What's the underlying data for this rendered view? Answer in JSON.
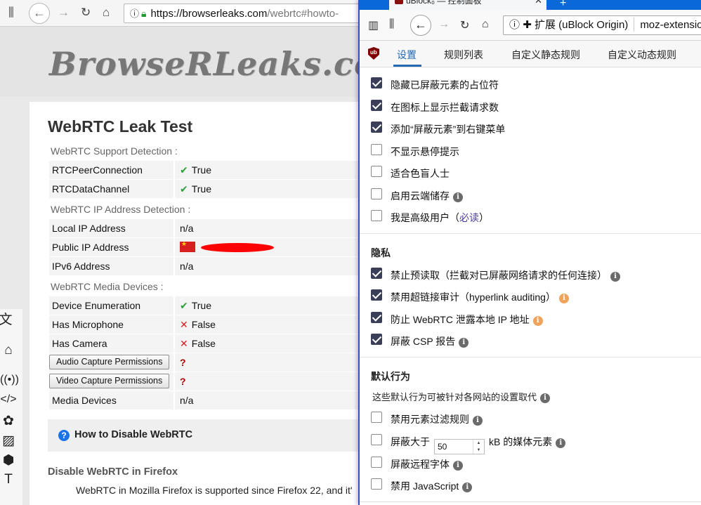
{
  "background_browser": {
    "url_host": "https://browserleaks.com",
    "url_path": "/webrtc#howto-",
    "logo_text": "BrowseRLeaks.com",
    "page_title": "WebRTC Leak Test",
    "support_section": "WebRTC Support Detection :",
    "ip_section": "WebRTC IP Address Detection :",
    "media_section": "WebRTC Media Devices :",
    "rows": {
      "rtcpeer": {
        "key": "RTCPeerConnection",
        "value": "True"
      },
      "rtcdata": {
        "key": "RTCDataChannel",
        "value": "True"
      },
      "local_ip": {
        "key": "Local IP Address",
        "value": "n/a"
      },
      "public_ip": {
        "key": "Public IP Address"
      },
      "ipv6": {
        "key": "IPv6 Address",
        "value": "n/a"
      },
      "enum": {
        "key": "Device Enumeration",
        "value": "True"
      },
      "mic": {
        "key": "Has Microphone",
        "value": "False"
      },
      "cam": {
        "key": "Has Camera",
        "value": "False"
      },
      "audio_btn": {
        "key": "Audio Capture Permissions",
        "value": "?"
      },
      "video_btn": {
        "key": "Video Capture Permissions",
        "value": "?"
      },
      "media_devices": {
        "key": "Media Devices",
        "value": "n/a"
      }
    },
    "howto_title": "How to Disable WebRTC",
    "firefox_heading": "Disable WebRTC in Firefox",
    "firefox_para": "WebRTC in Mozilla Firefox is supported since Firefox 22, and it'"
  },
  "ublock_window": {
    "tab_title": "uBlock₀ — 控制面板",
    "url_ext_label": "扩展 (uBlock Origin)",
    "url_text": "moz-extensio",
    "nav_tabs": [
      "设置",
      "规则列表",
      "自定义静态规则",
      "自定义动态规则"
    ],
    "options_general": [
      {
        "label": "隐藏已屏蔽元素的占位符",
        "checked": true
      },
      {
        "label": "在图标上显示拦截请求数",
        "checked": true
      },
      {
        "label": "添加“屏蔽元素”到右键菜单",
        "checked": true
      },
      {
        "label": "不显示悬停提示",
        "checked": false
      },
      {
        "label": "适合色盲人士",
        "checked": false
      },
      {
        "label": "启用云端储存",
        "checked": false
      },
      {
        "label": "我是高级用户（",
        "link": "必读",
        "suffix": "）",
        "checked": false
      }
    ],
    "privacy_title": "隐私",
    "options_privacy": [
      {
        "label": "禁止预读取（拦截对已屏蔽网络请求的任何连接）",
        "checked": true
      },
      {
        "label": "禁用超链接审计（hyperlink auditing）",
        "checked": true
      },
      {
        "label": "防止 WebRTC 泄露本地 IP 地址",
        "checked": true
      },
      {
        "label": "屏蔽 CSP 报告",
        "checked": true
      }
    ],
    "default_title": "默认行为",
    "default_desc": "这些默认行为可被针对各网站的设置取代",
    "options_default": [
      {
        "label": "禁用元素过滤规则",
        "checked": false
      },
      {
        "label_pre": "屏蔽大于",
        "input_value": "50",
        "label_post": "kB 的媒体元素",
        "checked": false
      },
      {
        "label": "屏蔽远程字体",
        "checked": false
      },
      {
        "label": "禁用 JavaScript",
        "checked": false
      }
    ]
  },
  "colors": {
    "accent": "#2469b3",
    "checkbox_on": "#3a3f57",
    "ok_green": "#2aa238",
    "fail_red": "#d9201f"
  }
}
